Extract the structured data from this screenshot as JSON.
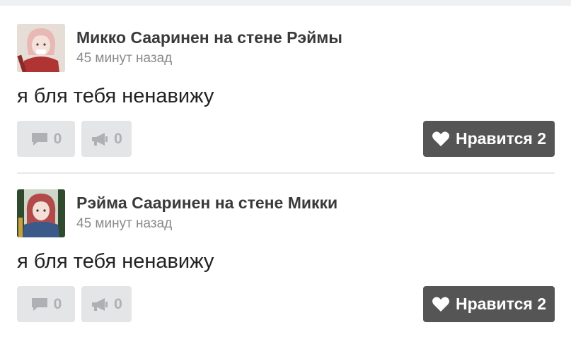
{
  "posts": [
    {
      "author_line": "Микко Сааринен на стене Рэймы",
      "timestamp": "45 минут назад",
      "text": "я бля тебя ненавижу",
      "comments_count": "0",
      "reposts_count": "0",
      "like_label": "Нравится 2",
      "avatar_icon": "avatar-pink-hair"
    },
    {
      "author_line": "Рэйма Сааринен на стене Микки",
      "timestamp": "45 минут назад",
      "text": "я бля тебя ненавижу",
      "comments_count": "0",
      "reposts_count": "0",
      "like_label": "Нравится 2",
      "avatar_icon": "avatar-red-hair"
    }
  ],
  "colors": {
    "like_button_bg": "#555555",
    "action_button_bg": "#e4e5e7",
    "action_icon": "#aeb0b4",
    "author_text": "#3a3a3a",
    "timestamp_text": "#8a8a8a"
  }
}
